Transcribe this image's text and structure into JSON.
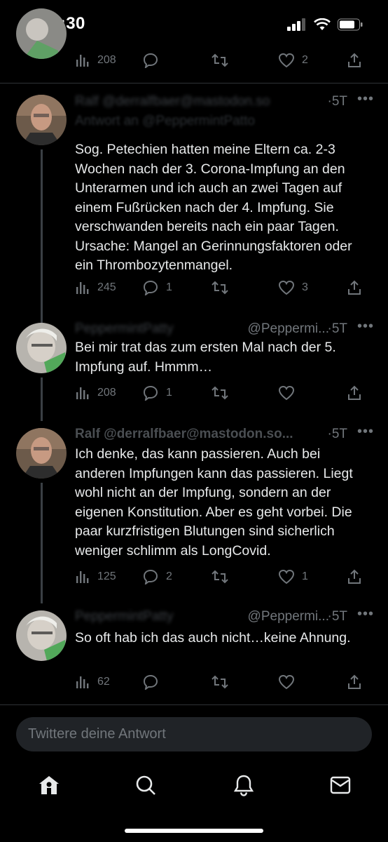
{
  "status_bar": {
    "time": "20:30"
  },
  "tweets": [
    {
      "stats": {
        "views": "208",
        "replies": "",
        "retweets": "",
        "likes": "2"
      }
    },
    {
      "name_blur": "Ralf @derralfbaer@mastodon.so",
      "time": "5T",
      "reply_to": "Antwort an @PeppermintPatto",
      "text": "Sog. Petechien hatten meine Eltern ca. 2-3 Wochen nach der 3. Corona-Impfung an den Unterarmen und ich auch an zwei Tagen auf einem Fußrücken nach der 4. Impfung. Sie verschwanden bereits nach ein paar Tagen. Ursache: Mangel an Gerinnungsfaktoren oder ein Thrombozytenmangel.",
      "stats": {
        "views": "245",
        "replies": "1",
        "retweets": "",
        "likes": "3"
      }
    },
    {
      "name_blur": "PeppermintPatty",
      "handle": "@Peppermi...",
      "time": "5T",
      "text": "Bei mir trat das zum ersten Mal nach der 5. Impfung auf. Hmmm…",
      "stats": {
        "views": "208",
        "replies": "1",
        "retweets": "",
        "likes": ""
      }
    },
    {
      "name": "Ralf @derralfbaer@mastodon.so...",
      "time": "5T",
      "text": "Ich denke, das kann passieren. Auch bei anderen Impfungen kann das passieren. Liegt wohl nicht an der Impfung, sondern an der eigenen Konstitution. Aber es geht vorbei. Die paar kurzfristigen Blutungen sind sicherlich weniger schlimm als LongCovid.",
      "stats": {
        "views": "125",
        "replies": "2",
        "retweets": "",
        "likes": "1"
      }
    },
    {
      "name_blur": "PeppermintPatty",
      "handle": "@Peppermi...",
      "time": "5T",
      "text": "So oft hab ich das auch nicht…keine Ahnung.",
      "stats": {
        "views": "62",
        "replies": "",
        "retweets": "",
        "likes": ""
      }
    }
  ],
  "reply_input": {
    "placeholder": "Twittere deine Antwort",
    "value": ""
  },
  "nav": {
    "items": [
      "home-icon",
      "search-icon",
      "notifications-icon",
      "messages-icon"
    ]
  },
  "colors": {
    "background": "#000000",
    "text": "#e7e9ea",
    "muted": "#71767b",
    "divider": "#2f3336",
    "input_bg": "#202327"
  }
}
